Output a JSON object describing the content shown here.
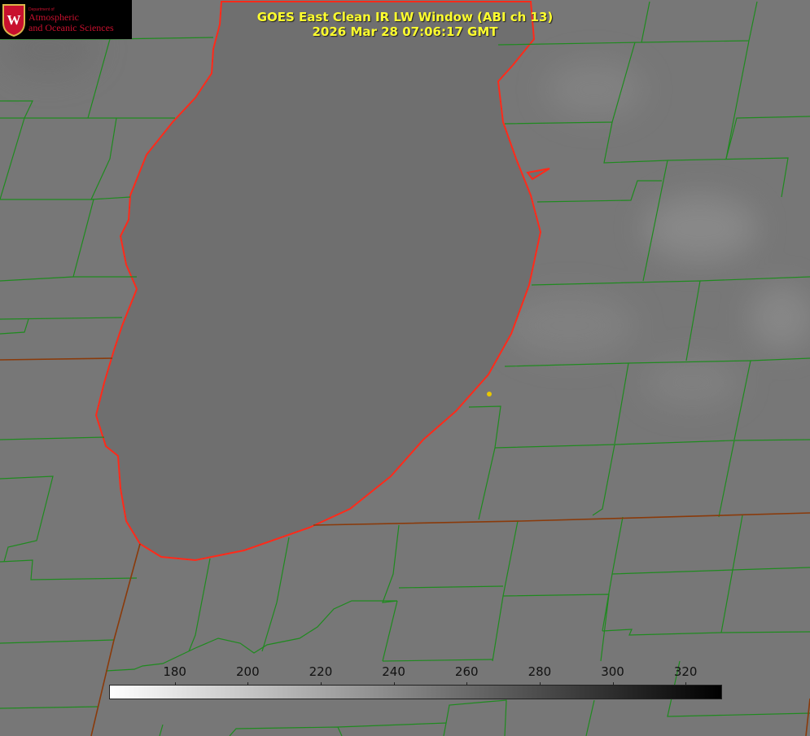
{
  "title": "GOES East Clean IR LW Window (ABI ch 13)",
  "timestamp": "2026 Mar 28 07:06:17 GMT",
  "logo": {
    "department": "Department of",
    "line1": "Atmospheric",
    "line2": "and Oceanic Sciences",
    "seal_letter": "W"
  },
  "colorbar": {
    "min": 162,
    "max": 330,
    "ticks": [
      "180",
      "200",
      "220",
      "240",
      "260",
      "280",
      "300",
      "320"
    ],
    "colormap": [
      "#ffffff",
      "#000000"
    ]
  },
  "colors": {
    "title": "#ffff2e",
    "lake_coast": "#ff2a1a",
    "county_border": "#1f8a1f",
    "state_border": "#8a3a0a",
    "marker": "#e8c800",
    "logo_text": "#c8102e"
  }
}
